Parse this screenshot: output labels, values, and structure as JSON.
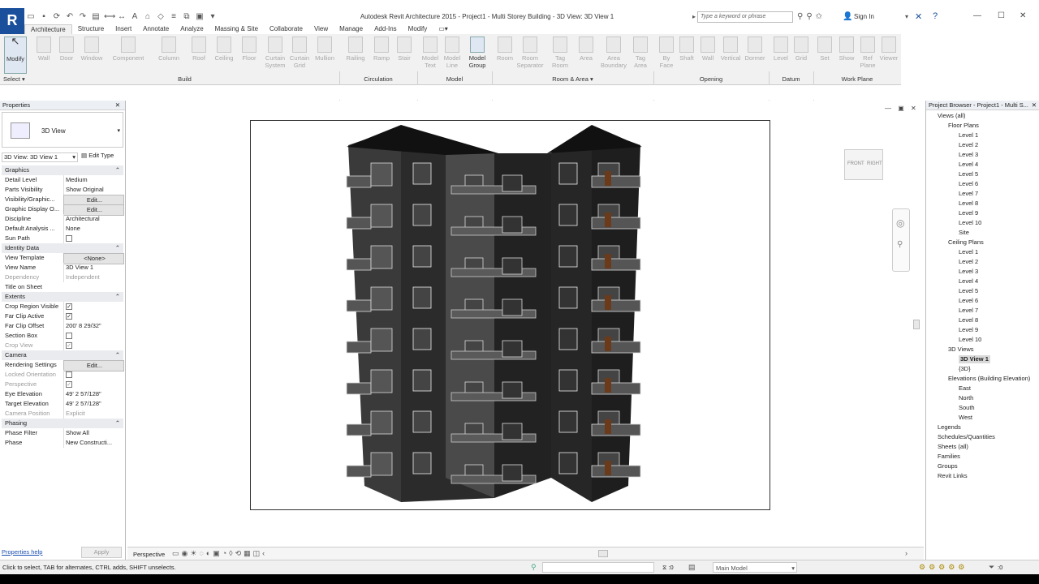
{
  "app": {
    "logo": "R",
    "title": "Autodesk Revit Architecture 2015 -    Project1 - Multi Storey Building - 3D View: 3D View 1",
    "search_placeholder": "Type a keyword or phrase",
    "sign_in": "Sign In"
  },
  "tabs": [
    "Architecture",
    "Structure",
    "Insert",
    "Annotate",
    "Analyze",
    "Massing & Site",
    "Collaborate",
    "View",
    "Manage",
    "Add-Ins",
    "Modify"
  ],
  "ribbon": {
    "modify": "Modify",
    "select": "Select",
    "buttons": [
      "Wall",
      "Door",
      "Window",
      "Component",
      "Column",
      "Roof",
      "Ceiling",
      "Floor",
      "Curtain System",
      "Curtain Grid",
      "Mullion",
      "Railing",
      "Ramp",
      "Stair",
      "Model Text",
      "Model Line",
      "Model Group",
      "Room",
      "Room Separator",
      "Tag Room",
      "Area",
      "Area Boundary",
      "Tag Area",
      "By Face",
      "Shaft",
      "Wall",
      "Vertical",
      "Dormer",
      "Level",
      "Grid",
      "Set",
      "Show",
      "Ref Plane",
      "Viewer"
    ],
    "panels": [
      "Build",
      "Circulation",
      "Model",
      "Room & Area",
      "Opening",
      "Datum",
      "Work Plane"
    ]
  },
  "properties": {
    "title": "Properties",
    "type_name": "3D View",
    "selector": "3D View: 3D View 1",
    "edit_type": "Edit Type",
    "rows": [
      {
        "k": "Graphics",
        "cat": true
      },
      {
        "k": "Detail Level",
        "v": "Medium"
      },
      {
        "k": "Parts Visibility",
        "v": "Show Original"
      },
      {
        "k": "Visibility/Graphic...",
        "v": "Edit...",
        "btn": true
      },
      {
        "k": "Graphic Display O...",
        "v": "Edit...",
        "btn": true
      },
      {
        "k": "Discipline",
        "v": "Architectural"
      },
      {
        "k": "Default Analysis ...",
        "v": "None"
      },
      {
        "k": "Sun Path",
        "v": "",
        "chk": ""
      },
      {
        "k": "Identity Data",
        "cat": true
      },
      {
        "k": "View Template",
        "v": "<None>",
        "btn": true
      },
      {
        "k": "View Name",
        "v": "3D View 1"
      },
      {
        "k": "Dependency",
        "v": "Independent",
        "grey": true
      },
      {
        "k": "Title on Sheet",
        "v": ""
      },
      {
        "k": "Extents",
        "cat": true
      },
      {
        "k": "Crop Region Visible",
        "v": "",
        "chk": "✓"
      },
      {
        "k": "Far Clip Active",
        "v": "",
        "chk": "✓"
      },
      {
        "k": "Far Clip Offset",
        "v": "200'  8 29/32\""
      },
      {
        "k": "Section Box",
        "v": "",
        "chk": ""
      },
      {
        "k": "Crop View",
        "v": "",
        "chk": "✓",
        "grey": true
      },
      {
        "k": "Camera",
        "cat": true
      },
      {
        "k": "Rendering Settings",
        "v": "Edit...",
        "btn": true
      },
      {
        "k": "Locked Orientation",
        "v": "",
        "chk": "",
        "grey": true
      },
      {
        "k": "Perspective",
        "v": "",
        "chk": "✓",
        "grey": true
      },
      {
        "k": "Eye Elevation",
        "v": "49'  2 57/128\""
      },
      {
        "k": "Target Elevation",
        "v": "49'  2 57/128\""
      },
      {
        "k": "Camera Position",
        "v": "Explicit",
        "grey": true
      },
      {
        "k": "Phasing",
        "cat": true
      },
      {
        "k": "Phase Filter",
        "v": "Show All"
      },
      {
        "k": "Phase",
        "v": "New Constructi..."
      }
    ],
    "help": "Properties help",
    "apply": "Apply"
  },
  "viewcube": {
    "front": "FRONT",
    "right": "RIGHT"
  },
  "view_bar": {
    "label": "Perspective"
  },
  "browser": {
    "title": "Project Browser - Project1 - Multi S...",
    "items": [
      {
        "t": "Views (all)",
        "d": 0
      },
      {
        "t": "Floor Plans",
        "d": 1
      },
      {
        "t": "Level 1",
        "d": 2
      },
      {
        "t": "Level 2",
        "d": 2
      },
      {
        "t": "Level 3",
        "d": 2
      },
      {
        "t": "Level 4",
        "d": 2
      },
      {
        "t": "Level 5",
        "d": 2
      },
      {
        "t": "Level 6",
        "d": 2
      },
      {
        "t": "Level 7",
        "d": 2
      },
      {
        "t": "Level 8",
        "d": 2
      },
      {
        "t": "Level 9",
        "d": 2
      },
      {
        "t": "Level 10",
        "d": 2
      },
      {
        "t": "Site",
        "d": 2
      },
      {
        "t": "Ceiling Plans",
        "d": 1
      },
      {
        "t": "Level 1",
        "d": 2
      },
      {
        "t": "Level 2",
        "d": 2
      },
      {
        "t": "Level 3",
        "d": 2
      },
      {
        "t": "Level 4",
        "d": 2
      },
      {
        "t": "Level 5",
        "d": 2
      },
      {
        "t": "Level 6",
        "d": 2
      },
      {
        "t": "Level 7",
        "d": 2
      },
      {
        "t": "Level 8",
        "d": 2
      },
      {
        "t": "Level 9",
        "d": 2
      },
      {
        "t": "Level 10",
        "d": 2
      },
      {
        "t": "3D Views",
        "d": 1
      },
      {
        "t": "3D View 1",
        "d": 2,
        "sel": true
      },
      {
        "t": "{3D}",
        "d": 2
      },
      {
        "t": "Elevations (Building Elevation)",
        "d": 1
      },
      {
        "t": "East",
        "d": 2
      },
      {
        "t": "North",
        "d": 2
      },
      {
        "t": "South",
        "d": 2
      },
      {
        "t": "West",
        "d": 2
      },
      {
        "t": "Legends",
        "d": 0
      },
      {
        "t": "Schedules/Quantities",
        "d": 0
      },
      {
        "t": "Sheets (all)",
        "d": 0
      },
      {
        "t": "Families",
        "d": 0
      },
      {
        "t": "Groups",
        "d": 0
      },
      {
        "t": "Revit Links",
        "d": 0
      }
    ]
  },
  "status": {
    "hint": "Click to select, TAB for alternates, CTRL adds, SHIFT unselects.",
    "zero": ":0",
    "model": "Main Model",
    "filter_count": ":0"
  }
}
